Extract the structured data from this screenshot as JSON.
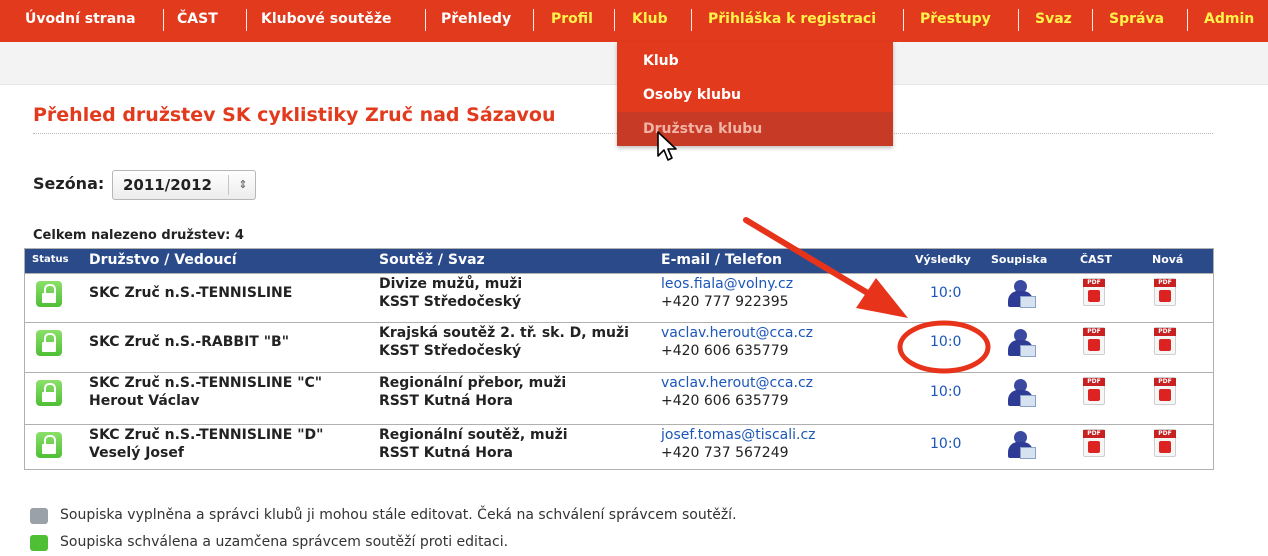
{
  "nav": {
    "items": [
      {
        "label": "Úvodní strana",
        "color": "#ffffff"
      },
      {
        "label": "ČAST",
        "color": "#ffffff"
      },
      {
        "label": "Klubové soutěže",
        "color": "#ffffff"
      },
      {
        "label": "Přehledy",
        "color": "#ffffff"
      },
      {
        "label": "Profil",
        "color": "#fff24a"
      },
      {
        "label": "Klub",
        "color": "#fff24a"
      },
      {
        "label": "Přihláška k registraci",
        "color": "#fff24a"
      },
      {
        "label": "Přestupy",
        "color": "#fff24a"
      },
      {
        "label": "Svaz",
        "color": "#fff24a"
      },
      {
        "label": "Správa",
        "color": "#fff24a"
      },
      {
        "label": "Admin",
        "color": "#fff24a"
      }
    ],
    "dropdown": [
      "Klub",
      "Osoby klubu",
      "Družstva klubu"
    ]
  },
  "page": {
    "title": "Přehled družstev SK cyklistiky Zruč nad Sázavou",
    "season_label": "Sezóna:",
    "season_value": "2011/2012",
    "count_text": "Celkem nalezeno družstev: 4"
  },
  "table": {
    "headers": {
      "status": "Status",
      "team": "Družstvo / Vedoucí",
      "competition": "Soutěž / Svaz",
      "contact": "E-mail / Telefon",
      "results": "Výsledky",
      "roster": "Soupiska",
      "cast": "ČAST",
      "new": "Nová"
    },
    "rows": [
      {
        "team": "SKC Zruč n.S.-TENNISLINE",
        "leader": "",
        "competition": "Divize mužů, muži",
        "association": "KSST Středočeský",
        "email": "leos.fiala@volny.cz",
        "phone": "+420 777 922395",
        "results": "10:0"
      },
      {
        "team": "SKC Zruč n.S.-RABBIT \"B\"",
        "leader": "",
        "competition": "Krajská soutěž 2. tř. sk. D, muži",
        "association": "KSST Středočeský",
        "email": "vaclav.herout@cca.cz",
        "phone": "+420 606 635779",
        "results": "10:0"
      },
      {
        "team": "SKC Zruč n.S.-TENNISLINE \"C\"",
        "leader": "Herout Václav",
        "competition": "Regionální přebor, muži",
        "association": "RSST Kutná Hora",
        "email": "vaclav.herout@cca.cz",
        "phone": "+420 606 635779",
        "results": "10:0"
      },
      {
        "team": "SKC Zruč n.S.-TENNISLINE \"D\"",
        "leader": "Veselý Josef",
        "competition": "Regionální soutěž, muži",
        "association": "RSST Kutná Hora",
        "email": "josef.tomas@tiscali.cz",
        "phone": "+420 737 567249",
        "results": "10:0"
      }
    ],
    "pdf_tag": "PDF"
  },
  "legend": [
    {
      "icon": "gray-lock-icon",
      "text": "Soupiska vyplněna a správci klubů ji mohou stále editovat. Čeká na schválení správcem soutěží."
    },
    {
      "icon": "green-lock-icon",
      "text": "Soupiska schválena a uzamčena správcem soutěží proti editaci."
    }
  ],
  "colors": {
    "nav_bg": "#e23a1c",
    "header_bg": "#2b4a8a",
    "link": "#1c56b8",
    "annotation": "#e8331b"
  }
}
